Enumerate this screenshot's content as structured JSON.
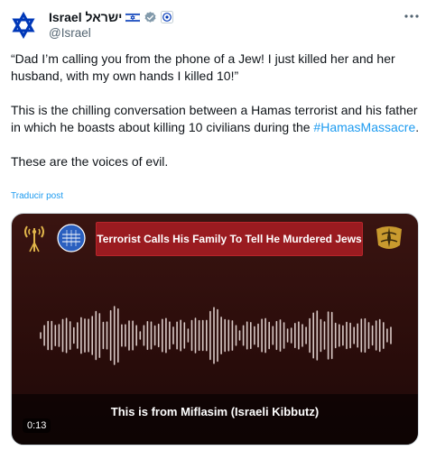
{
  "author": {
    "display_name": "Israel ישראל",
    "handle": "@Israel",
    "avatar_icon": "star-of-david-icon",
    "flag_icon": "israel-flag-icon",
    "verified_icon": "verified-badge-icon",
    "affiliation_icon": "government-affiliation-icon"
  },
  "more_icon": "more-options-icon",
  "tweet": {
    "paragraph1": "“Dad I’m calling you from the phone of a Jew! I just killed her and her husband, with my own hands I killed 10!”",
    "paragraph2_text": "This is the chilling conversation between a Hamas terrorist and his father in which he boasts about killing 10 civilians during the ",
    "paragraph2_hashtag": "#HamasMassacre",
    "paragraph2_end": ".",
    "paragraph3": "These are the voices of evil."
  },
  "translate_label": "Traducir post",
  "media": {
    "headline": "Terrorist Calls His Family To Tell He Murdered Jews",
    "caption": "This is from Miflasim (Israeli Kibbutz)",
    "time": "0:13",
    "left_logo_icon": "antenna-logo-icon",
    "mid_logo_icon": "intelligence-unit-logo-icon",
    "right_logo_icon": "idf-emblem-icon"
  },
  "colors": {
    "link": "#1d9bf0",
    "headline_bg": "#9a1b20",
    "media_bg": "#2b0d0b",
    "text": "#0f1419",
    "secondary": "#536471"
  }
}
